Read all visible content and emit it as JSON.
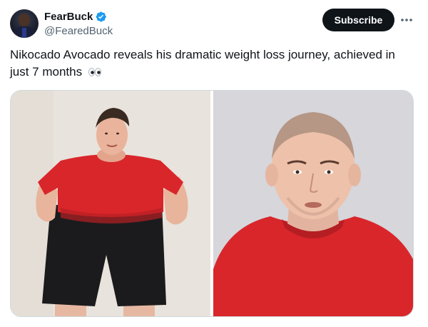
{
  "author": {
    "display_name": "FearBuck",
    "handle": "@FearedBuck",
    "verified": true,
    "avatar_icon": "profile-photo"
  },
  "actions": {
    "subscribe_label": "Subscribe",
    "more_icon": "ellipsis-icon"
  },
  "tweet": {
    "text": "Nikocado Avocado reveals his dramatic weight loss journey, achieved in just 7 months",
    "emoji": "eyes-emoji"
  },
  "media": {
    "count": 2,
    "images": [
      {
        "icon": "photo-before"
      },
      {
        "icon": "photo-after"
      }
    ]
  },
  "colors": {
    "text_primary": "#0f1419",
    "text_secondary": "#536471",
    "verified_blue": "#1d9bf0",
    "button_dark": "#0f1419",
    "shirt_red": "#d9262b"
  }
}
